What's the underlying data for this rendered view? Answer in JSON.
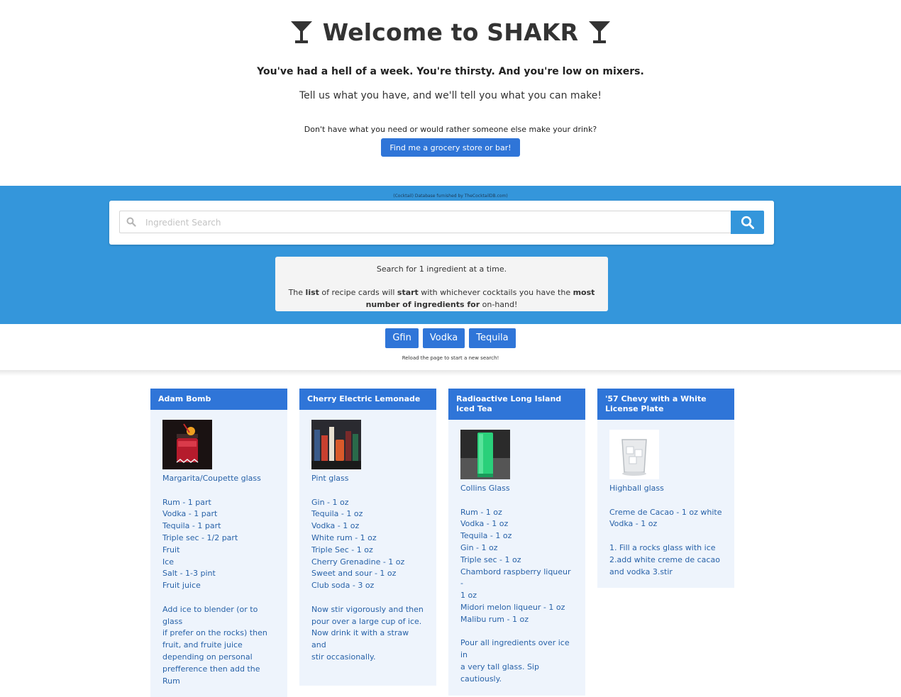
{
  "header": {
    "title": "Welcome to SHAKR",
    "tagline": "You've had a hell of a week. You're thirsty. And you're low on mixers.",
    "subline": "Tell us what you have, and we'll tell you what you can make!",
    "alt_question": "Don't have what you need or would rather someone else make your drink?",
    "find_button": "Find me a grocery store or bar!"
  },
  "search": {
    "credit": "(Cocktail) Database furnished by TheCocktailDB.com)",
    "placeholder": "Ingredient Search",
    "value": ""
  },
  "hint": {
    "line1": "Search for 1 ingredient at a time.",
    "line2_a": "The ",
    "line2_b": "list",
    "line2_c": " of recipe cards will ",
    "line2_d": "start",
    "line2_e": " with whichever cocktails you have the ",
    "line2_f": "most number of ingredients for",
    "line2_g": " on-hand!"
  },
  "chips": [
    "Gfin",
    "Vodka",
    "Tequila"
  ],
  "reload_note": "Reload the page to start a new search!",
  "cards": [
    {
      "name": "Adam Bomb",
      "glass": "Margarita/Coupette glass",
      "ingredients": [
        "Rum - 1 part",
        "Vodka - 1 part",
        "Tequila - 1 part",
        "Triple sec - 1/2 part",
        "Fruit",
        "Ice",
        "Salt - 1-3 pint",
        "Fruit juice"
      ],
      "instructions": [
        "Add ice to blender (or to glass",
        "if prefer on the rocks) then",
        "fruit, and fruite juice",
        "depending on personal",
        "prefference then add the Rum"
      ]
    },
    {
      "name": "Cherry Electric Lemonade",
      "glass": "Pint glass",
      "ingredients": [
        "Gin - 1 oz",
        "Tequila - 1 oz",
        "Vodka - 1 oz",
        "White rum - 1 oz",
        "Triple Sec - 1 oz",
        "Cherry Grenadine - 1 oz",
        "Sweet and sour - 1 oz",
        "Club soda - 3 oz"
      ],
      "instructions": [
        "Now stir vigorously and then",
        "pour over a large cup of ice.",
        "Now drink it with a straw and",
        "stir occasionally."
      ]
    },
    {
      "name": "Radioactive Long Island Iced Tea",
      "glass": "Collins Glass",
      "ingredients": [
        "Rum - 1 oz",
        "Vodka - 1 oz",
        "Tequila - 1 oz",
        "Gin - 1 oz",
        "Triple sec - 1 oz",
        "Chambord raspberry liqueur -",
        "1 oz",
        "Midori melon liqueur - 1 oz",
        "Malibu rum - 1 oz"
      ],
      "instructions": [
        "Pour all ingredients over ice in",
        "a very tall glass. Sip cautiously."
      ]
    },
    {
      "name": "'57 Chevy with a White License Plate",
      "glass": "Highball glass",
      "ingredients": [
        "Creme de Cacao - 1 oz white",
        "Vodka - 1 oz"
      ],
      "instructions": [
        "1. Fill a rocks glass with ice",
        "2.add white creme de cacao",
        "and vodka 3.stir"
      ]
    }
  ],
  "colors": {
    "accent": "#2f75d8",
    "band": "#3496db",
    "card_bg": "#eef4fc",
    "card_text": "#2862a8"
  },
  "icons": {
    "title_left": "cocktail-glass-icon",
    "title_right": "cocktail-glass-icon",
    "search_field": "magnifier-icon",
    "search_button": "search-icon"
  }
}
